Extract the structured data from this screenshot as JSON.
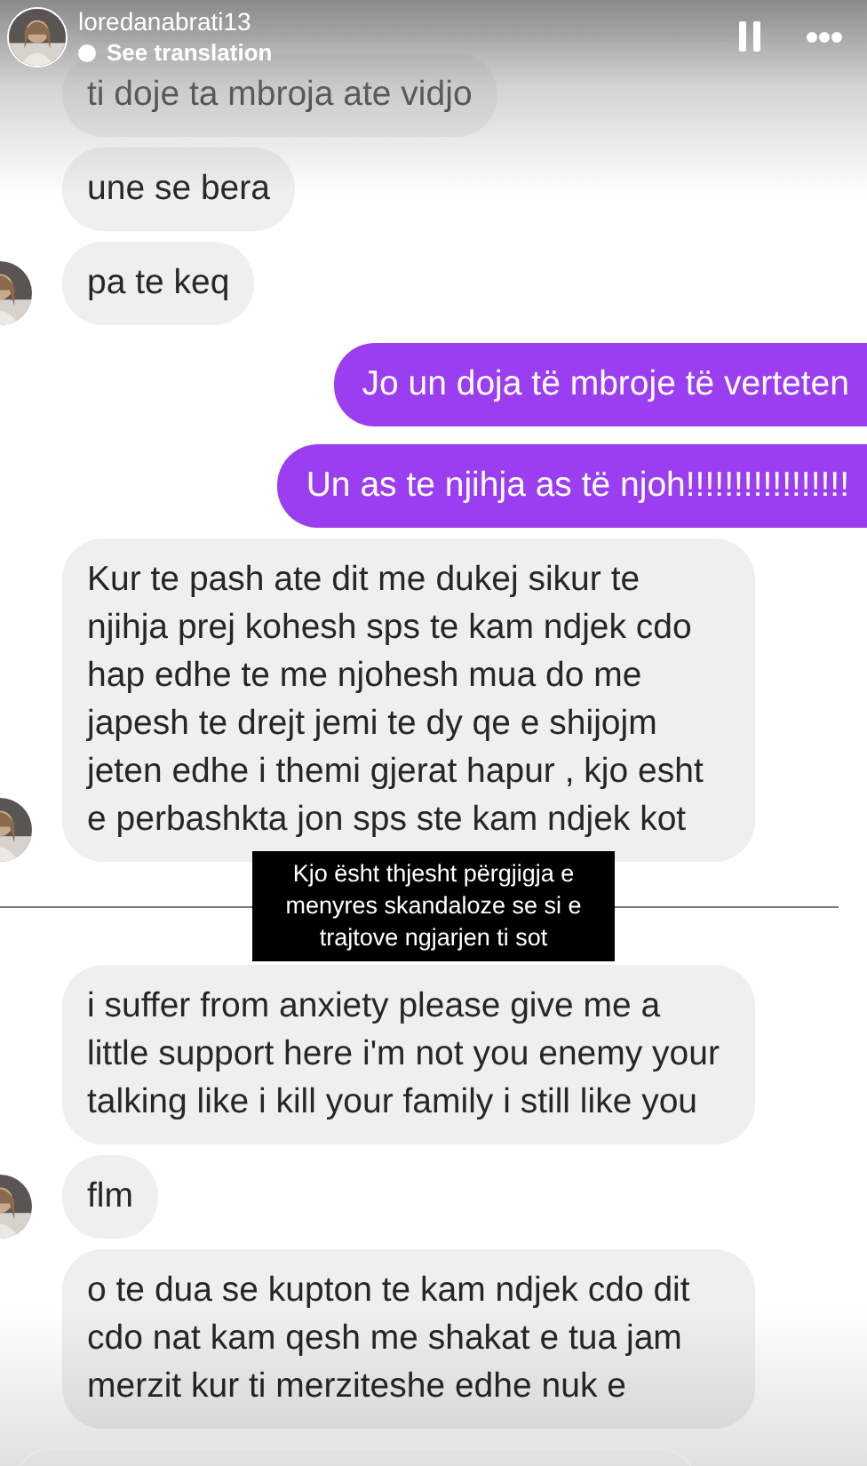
{
  "story": {
    "username": "loredanabrati13",
    "translation_link": "See translation"
  },
  "messages": [
    {
      "kind": "cut",
      "avatar": false
    },
    {
      "kind": "incoming",
      "text": "ti doje ta mbroja ate vidjo",
      "avatar": false
    },
    {
      "kind": "incoming",
      "text": "une se bera",
      "avatar": false
    },
    {
      "kind": "incoming",
      "text": "pa te keq",
      "avatar": true
    },
    {
      "kind": "outgoing",
      "text": "Jo un doja të mbroje të verteten"
    },
    {
      "kind": "outgoing",
      "text": "Un as te njihja as të njoh!!!!!!!!!!!!!!!!!"
    },
    {
      "kind": "incoming",
      "text": "Kur te pash ate dit me dukej sikur te njihja prej kohesh sps te kam ndjek cdo hap edhe te me njohesh mua do me japesh te drejt jemi te dy qe e shijojm jeten edhe i themi gjerat hapur , kjo esht e perbashkta jon sps ste kam ndjek kot",
      "avatar": true
    },
    {
      "kind": "separator",
      "text": "Kjo ësht thjesht përgjigja e menyres skandaloze se si e trajtove ngjarjen ti sot"
    },
    {
      "kind": "incoming",
      "text": "i suffer from anxiety please give me a little support here i'm not you enemy your talking like i kill your family i still like you",
      "avatar": false
    },
    {
      "kind": "incoming",
      "text": "flm",
      "avatar": true
    },
    {
      "kind": "incoming",
      "text": "o te dua se kupton te kam ndjek cdo dit cdo nat kam qesh me shakat e tua jam merzit kur ti merziteshe edhe nuk e",
      "avatar": false
    }
  ]
}
